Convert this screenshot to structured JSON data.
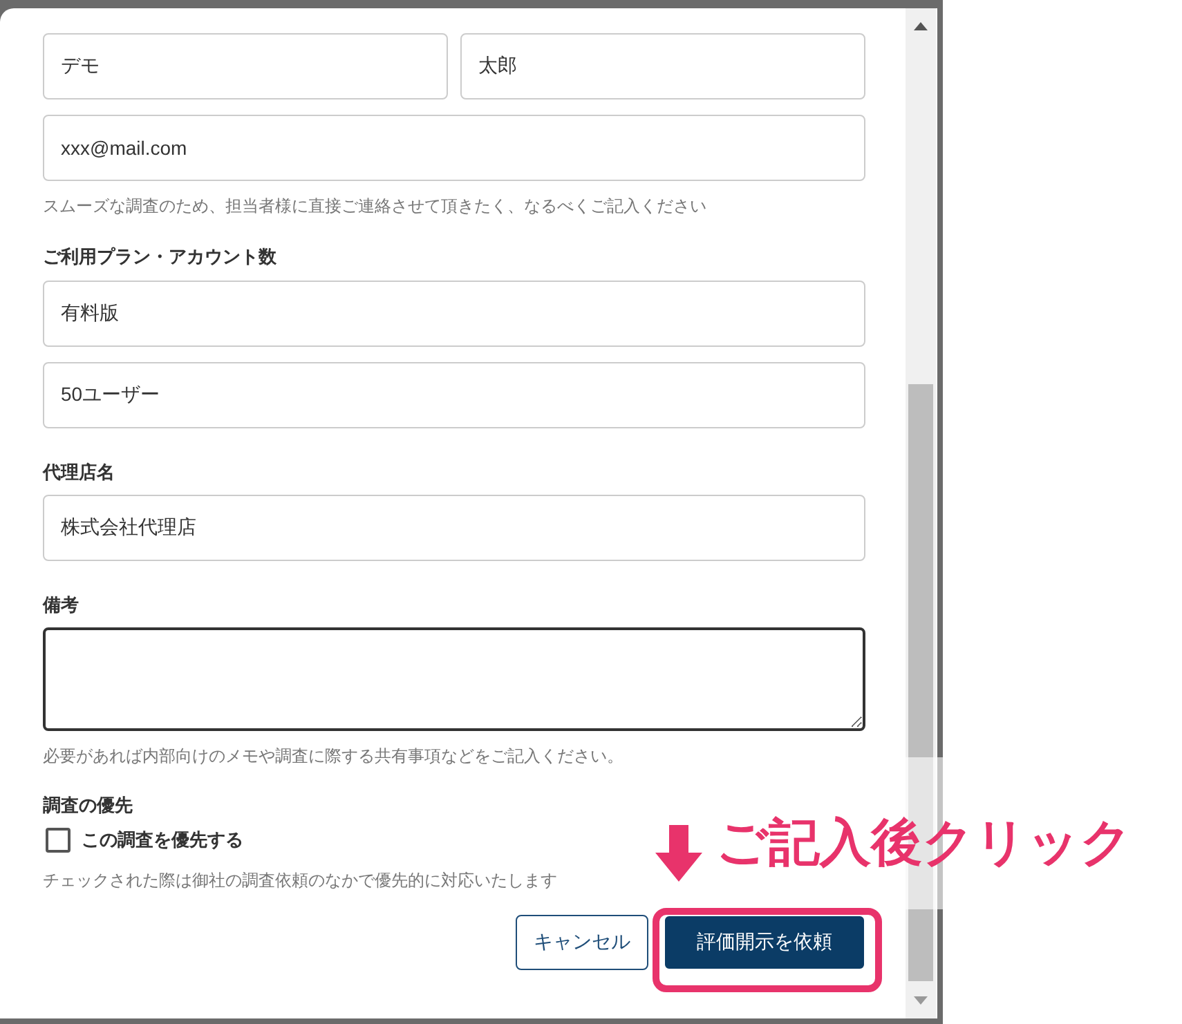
{
  "form": {
    "last_name": {
      "value": "デモ"
    },
    "first_name": {
      "value": "太郎"
    },
    "email": {
      "value": "xxx@mail.com"
    },
    "contact_hint": "スムーズな調査のため、担当者様に直接ご連絡させて頂きたく、なるべくご記入ください",
    "plan_label": "ご利用プラン・アカウント数",
    "plan": {
      "value": "有料版"
    },
    "accounts": {
      "value": "50ユーザー"
    },
    "agency_label": "代理店名",
    "agency": {
      "value": "株式会社代理店"
    },
    "notes_label": "備考",
    "notes_hint": "必要があれば内部向けのメモや調査に際する共有事項などをご記入ください。",
    "priority_label": "調査の優先",
    "priority_checkbox": {
      "label": "この調査を優先する",
      "checked": false
    },
    "priority_hint": "チェックされた際は御社の調査依頼のなかで優先的に対応いたします",
    "buttons": [
      {
        "kind": "secondary",
        "label": "キャンセル"
      },
      {
        "kind": "primary",
        "label": "評価開示を依頼"
      }
    ]
  },
  "annotation": {
    "text": "ご記入後クリック"
  }
}
